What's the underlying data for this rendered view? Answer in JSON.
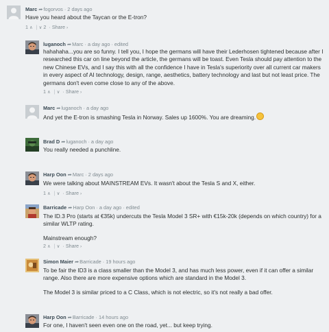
{
  "comments": [
    {
      "author": "Marc",
      "reply_to": "fogorvos",
      "time": "2 days ago",
      "edited": "",
      "paragraphs": [
        "Have you heard about the Taycan or the E-tron?"
      ],
      "upvotes": "1",
      "downvotes": "2",
      "share": "Share",
      "avatar": "default"
    },
    {
      "author": "luganoch",
      "reply_to": "Marc",
      "time": "a day ago",
      "edited": "edited",
      "paragraphs": [
        "hahahaha...you are so funny. I tell you, I hope the germans will have their Lederhosen tightened because after I researched this car on line beyond the article, the germans will be toast. Even Tesla should pay attention to the new Chinese EVs, and I say this with all the confidence I have in Tesla's superiority over all current car makers in every aspect of AI technology, design, range, aesthetics, battery technology and last but not least price. The germans don't even come close to any of the above."
      ],
      "upvotes": "1",
      "downvotes": "",
      "share": "Share",
      "avatar": "man"
    },
    {
      "author": "Marc",
      "reply_to": "luganoch",
      "time": "a day ago",
      "edited": "",
      "paragraphs": [
        "And yet the E-tron is smashing Tesla in Norway. Sales up 1600%. You are dreaming."
      ],
      "upvotes": "",
      "downvotes": "",
      "share": "",
      "avatar": "default"
    },
    {
      "author": "Brad D",
      "reply_to": "luganoch",
      "time": "a day ago",
      "edited": "",
      "paragraphs": [
        "You really needed a punchline."
      ],
      "upvotes": "",
      "downvotes": "",
      "share": "",
      "avatar": "brad"
    },
    {
      "author": "Harp Oon",
      "reply_to": "Marc",
      "time": "2 days ago",
      "edited": "",
      "paragraphs": [
        "We were talking about MAINSTREAM EVs. It wasn't about the Tesla S and X, either."
      ],
      "upvotes": "1",
      "downvotes": "",
      "share": "Share",
      "avatar": "man"
    },
    {
      "author": "Barricade",
      "reply_to": "Harp Oon",
      "time": "a day ago",
      "edited": "edited",
      "paragraphs": [
        "The ID.3 Pro (starts at €35k) undercuts the Tesla Model 3 SR+ with €15k-20k (depends on which country) for a similar WLTP rating.",
        "Mainstream enough?"
      ],
      "upvotes": "2",
      "downvotes": "",
      "share": "Share",
      "avatar": "barricade"
    },
    {
      "author": "Simon Maier",
      "reply_to": "Barricade",
      "time": "19 hours ago",
      "edited": "",
      "paragraphs": [
        "To be fair the ID3 is a class smaller than the Model 3, and has much less power, even if it can offer a similar range. Also there are more expensive options which are standard in the Model 3.",
        "The Model 3 is similar priced to a C Class, which is not electric, so it's not really a bad offer."
      ],
      "upvotes": "",
      "downvotes": "",
      "share": "",
      "avatar": "simon"
    },
    {
      "author": "Harp Oon",
      "reply_to": "Barricade",
      "time": "14 hours ago",
      "edited": "",
      "paragraphs": [
        "For one, I haven't seen even one on the road, yet... but keep trying."
      ],
      "upvotes": "",
      "downvotes": "",
      "share": "",
      "avatar": "man"
    }
  ]
}
